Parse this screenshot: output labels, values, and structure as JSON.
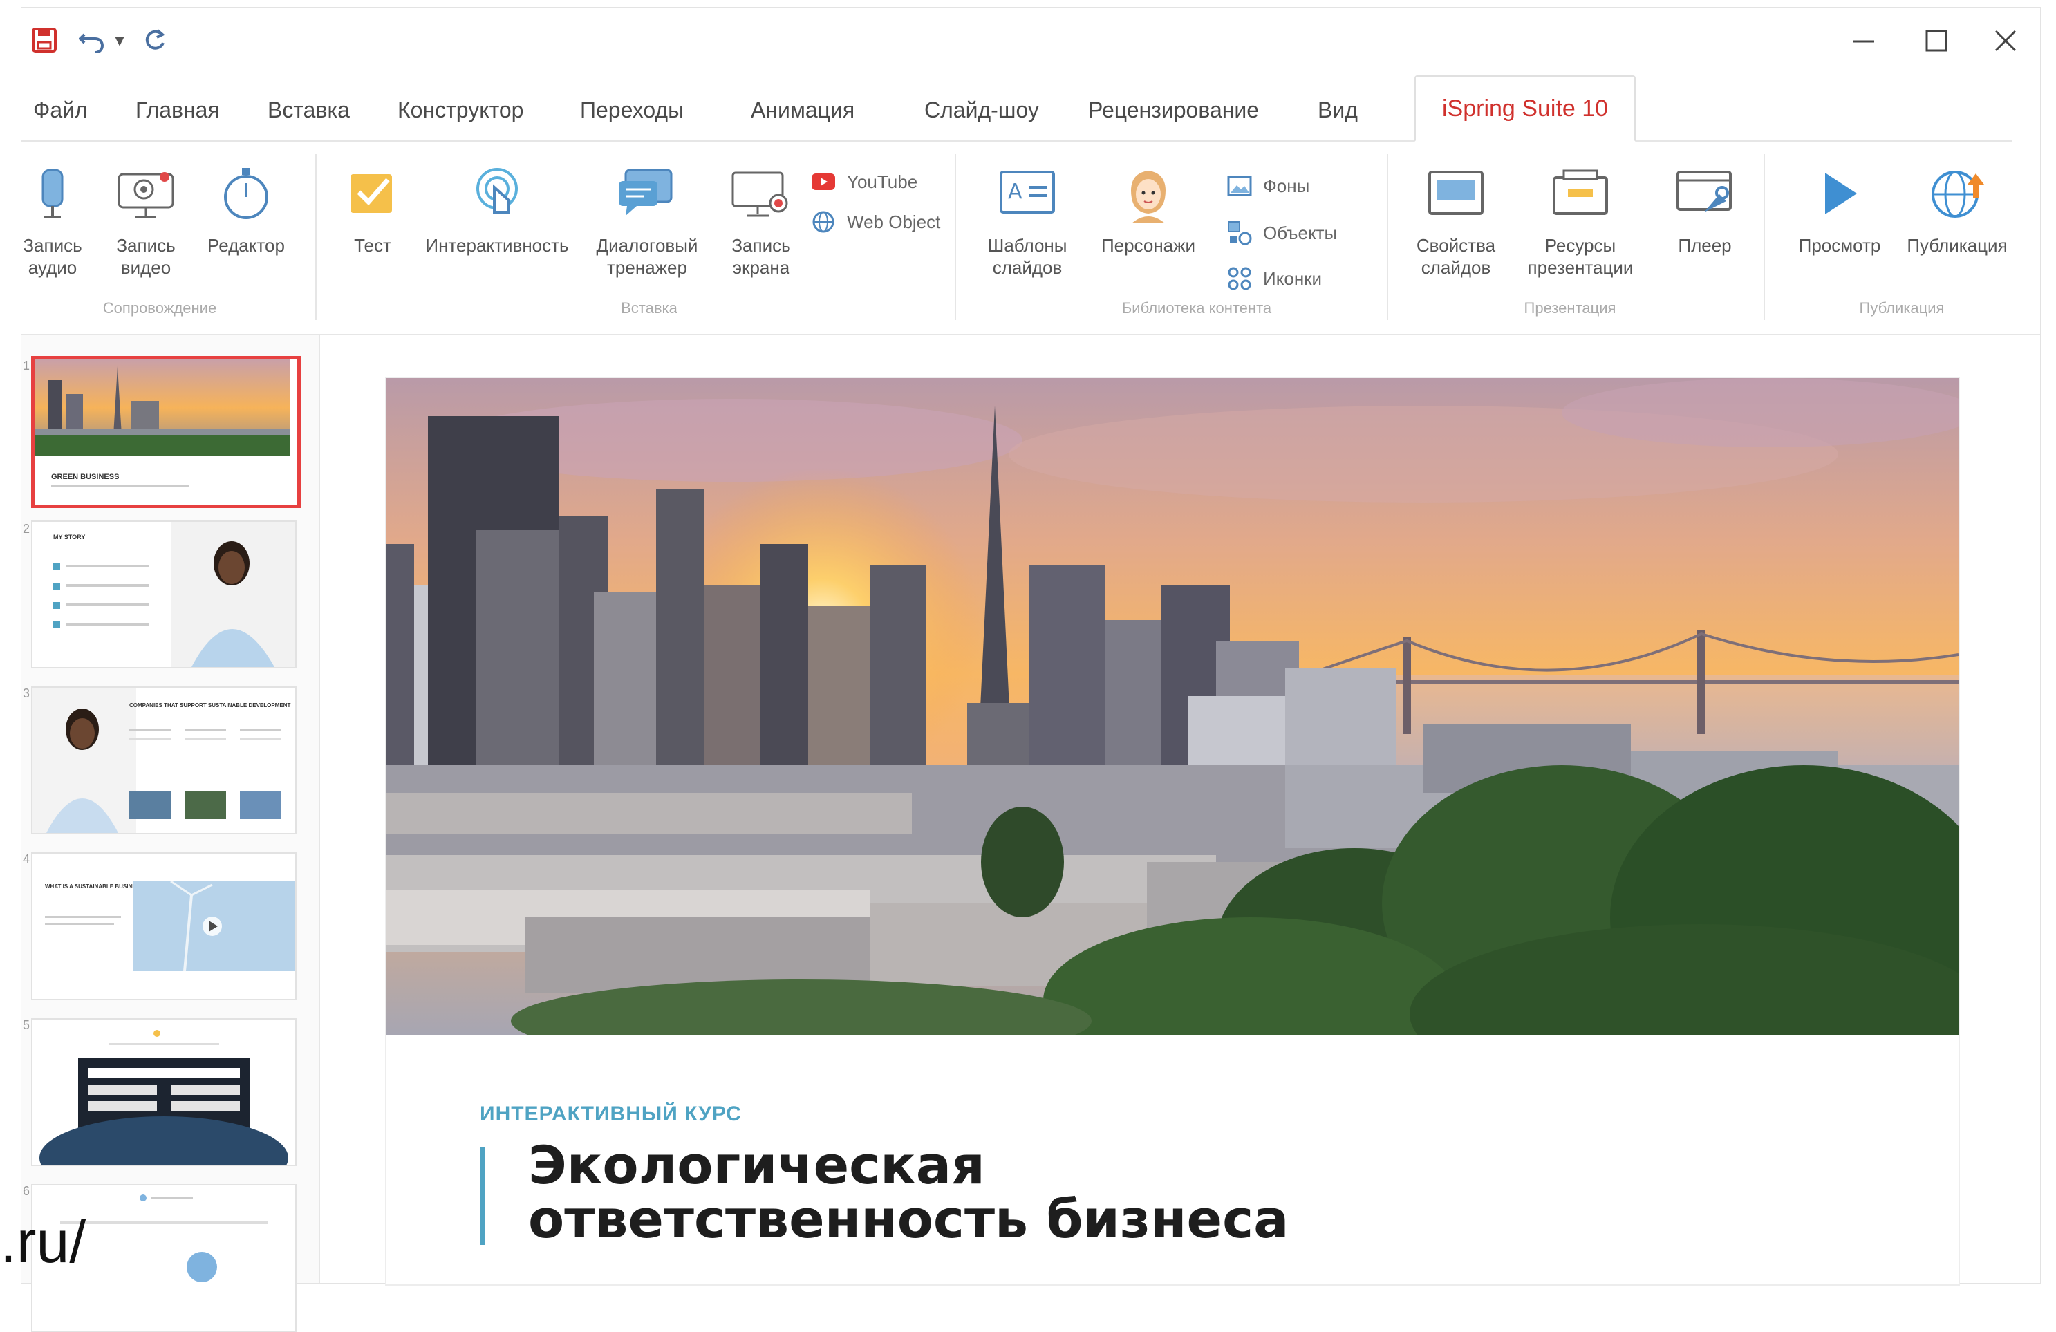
{
  "titlebar": {
    "save_icon": "save-icon",
    "undo_icon": "undo-icon",
    "redo_icon": "redo-icon"
  },
  "tabs": [
    "Файл",
    "Главная",
    "Вставка",
    "Конструктор",
    "Переходы",
    "Анимация",
    "Слайд-шоу",
    "Рецензирование",
    "Вид"
  ],
  "active_tab": "iSpring Suite 10",
  "ribbon": {
    "accompaniment": {
      "group": "Сопровождение",
      "audio": "Запись\nаудио",
      "video": "Запись\nвидео",
      "editor": "Редактор"
    },
    "insert": {
      "group": "Вставка",
      "test": "Тест",
      "interactivity": "Интерактивность",
      "dialog": "Диалоговый\nтренажер",
      "screen": "Запись\nэкрана",
      "youtube": "YouTube",
      "web_object": "Web Object"
    },
    "library": {
      "group": "Библиотека контента",
      "templates": "Шаблоны\nслайдов",
      "characters": "Персонажи",
      "backgrounds": "Фоны",
      "objects": "Объекты",
      "icons": "Иконки"
    },
    "presentation": {
      "group": "Презентация",
      "slide_props": "Свойства\nслайдов",
      "resources": "Ресурсы\nпрезентации",
      "player": "Плеер"
    },
    "publish": {
      "group": "Публикация",
      "preview": "Просмотр",
      "publish": "Публикация"
    }
  },
  "thumbnails": {
    "numbers": [
      "1",
      "2",
      "3",
      "4",
      "5",
      "6"
    ],
    "t1_caption": "GREEN BUSINESS",
    "t2_title": "MY STORY",
    "t3_title": "COMPANIES THAT SUPPORT SUSTAINABLE DEVELOPMENT",
    "t4_title": "WHAT IS A SUSTAINABLE BUSINESS?"
  },
  "slide": {
    "kicker": "ИНТЕРАКТИВНЫЙ КУРС",
    "title_line1": "Экологическая",
    "title_line2": "ответственность бизнеса"
  },
  "watermark": ".ru/",
  "colors": {
    "accent": "#d0312d",
    "blue": "#4fa3c3",
    "selection": "#e74040"
  }
}
